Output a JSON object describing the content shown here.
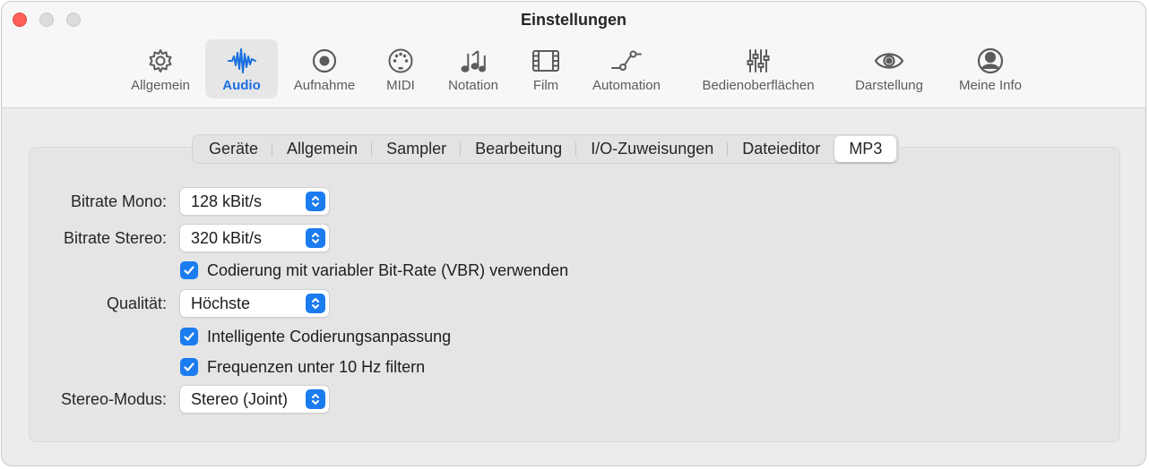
{
  "window": {
    "title": "Einstellungen"
  },
  "toolbar": {
    "items": [
      {
        "label": "Allgemein",
        "icon": "gear-icon"
      },
      {
        "label": "Audio",
        "icon": "waveform-icon",
        "active": true
      },
      {
        "label": "Aufnahme",
        "icon": "record-icon"
      },
      {
        "label": "MIDI",
        "icon": "midi-port-icon"
      },
      {
        "label": "Notation",
        "icon": "music-notes-icon"
      },
      {
        "label": "Film",
        "icon": "film-icon"
      },
      {
        "label": "Automation",
        "icon": "automation-curve-icon"
      },
      {
        "label": "Bedienoberflächen",
        "icon": "sliders-icon"
      },
      {
        "label": "Darstellung",
        "icon": "eye-icon"
      },
      {
        "label": "Meine Info",
        "icon": "person-icon"
      }
    ]
  },
  "tabs": {
    "items": [
      "Geräte",
      "Allgemein",
      "Sampler",
      "Bearbeitung",
      "I/O-Zuweisungen",
      "Dateieditor",
      "MP3"
    ],
    "selected": "MP3"
  },
  "mp3": {
    "bitrate_mono": {
      "label": "Bitrate Mono:",
      "value": "128 kBit/s"
    },
    "bitrate_stereo": {
      "label": "Bitrate Stereo:",
      "value": "320 kBit/s"
    },
    "vbr": {
      "label": "Codierung mit variabler Bit-Rate (VBR) verwenden",
      "checked": true
    },
    "quality": {
      "label": "Qualität:",
      "value": "Höchste"
    },
    "smart_encoding": {
      "label": "Intelligente Codierungsanpassung",
      "checked": true
    },
    "filter": {
      "label": "Frequenzen unter 10 Hz filtern",
      "checked": true
    },
    "stereo_mode": {
      "label": "Stereo-Modus:",
      "value": "Stereo (Joint)"
    }
  },
  "colors": {
    "accent": "#1b7cf0",
    "close_button": "#fe5f57"
  }
}
